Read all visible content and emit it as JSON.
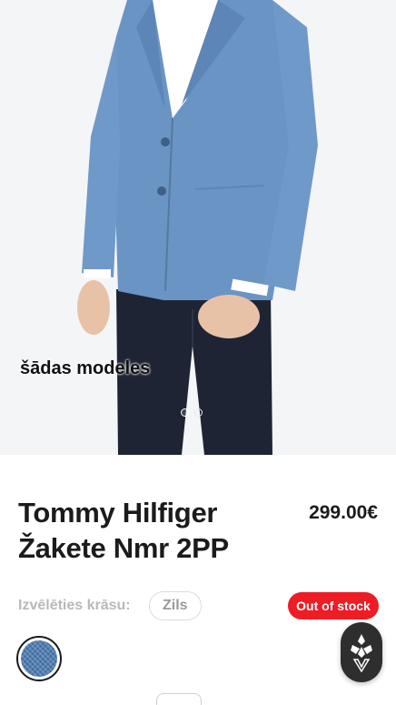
{
  "hero": {
    "caption": "šādas modeles",
    "slides_total": 2,
    "active_slide": 1
  },
  "product": {
    "title": "Tommy Hilfiger Žakete Nmr 2PP",
    "price": "299.00€"
  },
  "color": {
    "label": "Izvēlēties krāsu:",
    "selected": "Zils",
    "swatch_color": "#4f7fb4"
  },
  "stock": {
    "status": "Out of stock",
    "color": "#ee1c25"
  },
  "fab": {
    "icon": "brand-logo-icon"
  }
}
